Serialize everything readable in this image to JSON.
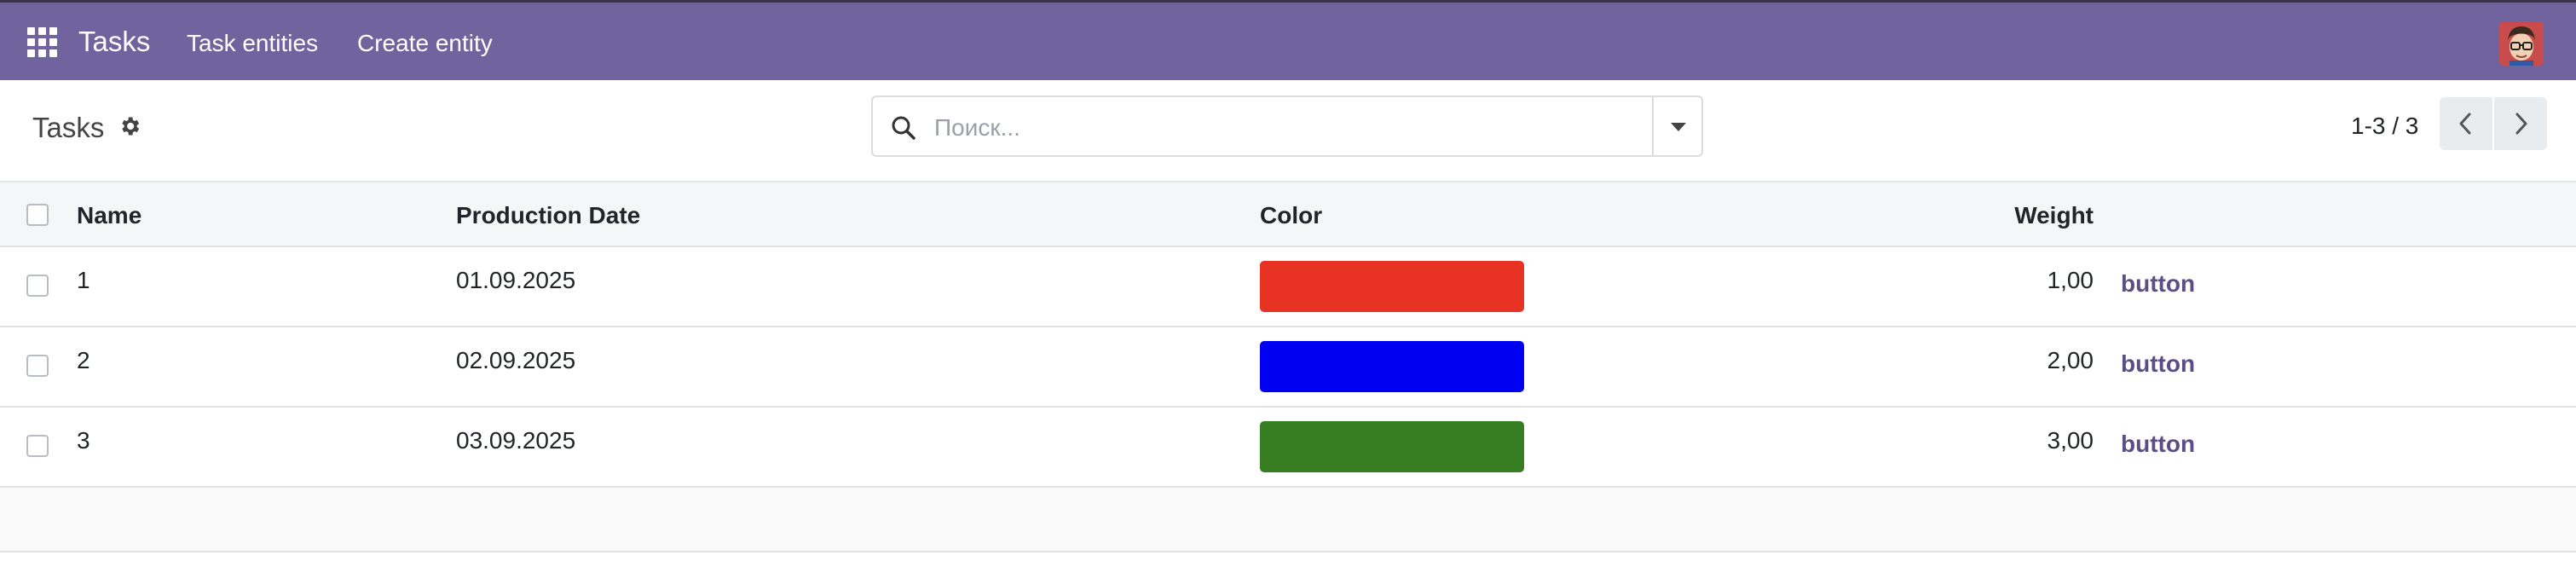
{
  "navbar": {
    "app_title": "Tasks",
    "menu": [
      "Task entities",
      "Create entity"
    ],
    "apps_icon": "grid-icon",
    "avatar_icon": "user-avatar"
  },
  "control_panel": {
    "title": "Tasks",
    "settings_icon": "gear-icon",
    "search": {
      "placeholder": "Поиск...",
      "value": ""
    },
    "pager": "1-3 / 3"
  },
  "table": {
    "columns": {
      "name": "Name",
      "production_date": "Production Date",
      "color": "Color",
      "weight": "Weight"
    },
    "rows": [
      {
        "name": "1",
        "production_date": "01.09.2025",
        "color": "#e83324",
        "weight": "1,00",
        "button": "button"
      },
      {
        "name": "2",
        "production_date": "02.09.2025",
        "color": "#0000f2",
        "weight": "2,00",
        "button": "button"
      },
      {
        "name": "3",
        "production_date": "03.09.2025",
        "color": "#377e22",
        "weight": "3,00",
        "button": "button"
      }
    ]
  },
  "colors": {
    "navbar": "#71639e",
    "link": "#5b4e86"
  }
}
